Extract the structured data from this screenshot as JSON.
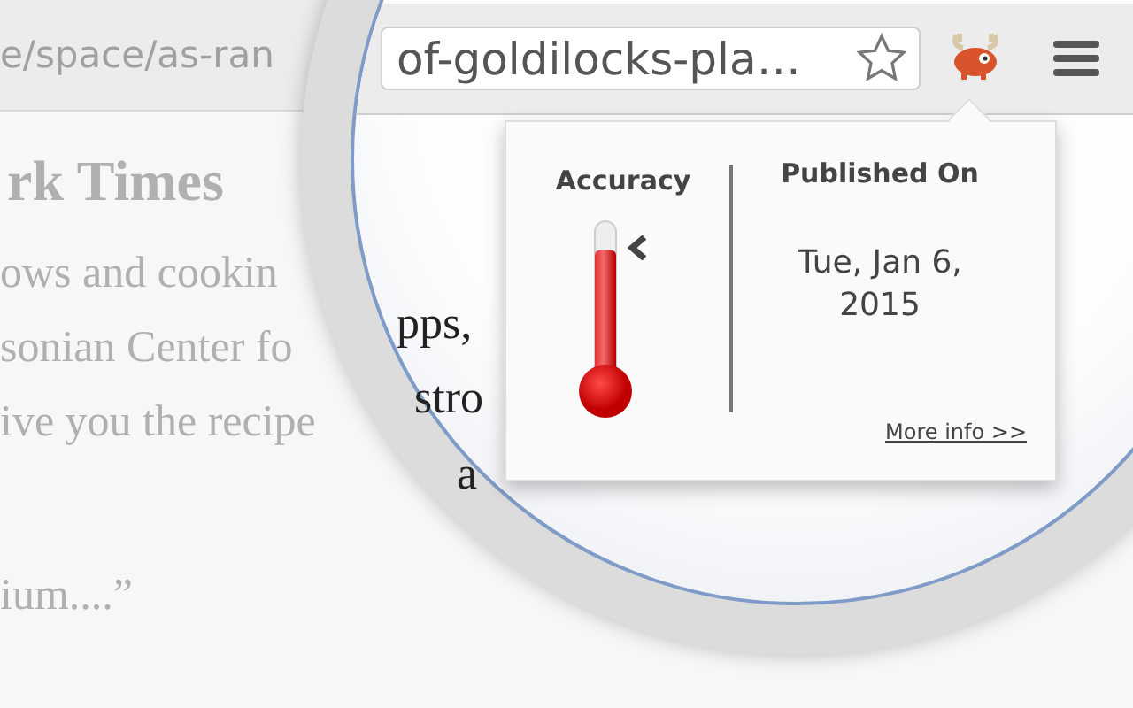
{
  "browser": {
    "url_faded": "e/space/as-ran",
    "url": "of-goldilocks-pla…",
    "bookmarked": false
  },
  "page": {
    "masthead": "rk Times",
    "lines": [
      {
        "faded": "ows and cookin",
        "magnified": "pps,"
      },
      {
        "faded": "sonian Center fo",
        "magnified": "stro"
      },
      {
        "faded": "ive you the recipe",
        "magnified": "a"
      },
      {
        "faded": "ium....”"
      }
    ]
  },
  "popup": {
    "accuracy": {
      "label": "Accuracy",
      "level": 0.82
    },
    "published": {
      "label": "Published On",
      "date": "Tue, Jan 6, 2015"
    },
    "link": "More info >>"
  }
}
